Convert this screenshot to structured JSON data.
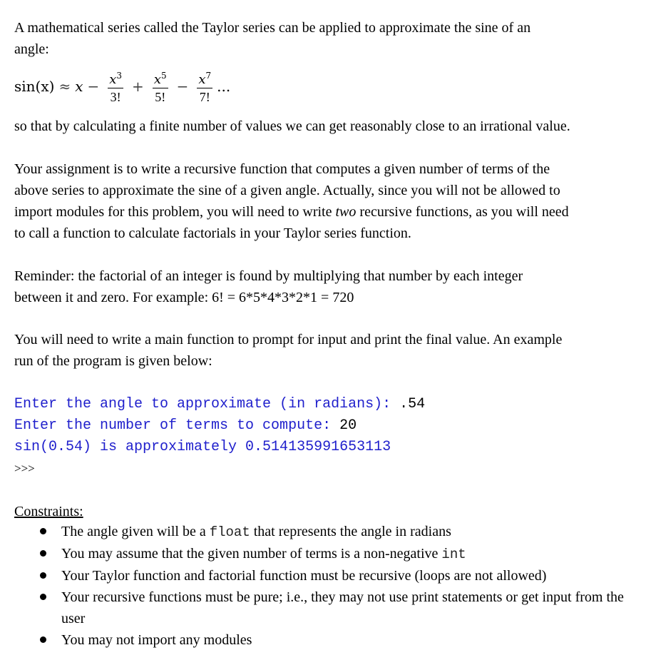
{
  "intro": {
    "line1": "A mathematical series called the Taylor series can be applied to approximate the sine of an",
    "line2": "angle:"
  },
  "formula": {
    "lhs": "sin(x)",
    "approx": "≈",
    "x": "x",
    "minus1": "−",
    "term1_num": "x",
    "term1_exp": "3",
    "term1_den": "3!",
    "plus": "+",
    "term2_num": "x",
    "term2_exp": "5",
    "term2_den": "5!",
    "minus2": "−",
    "term3_num": "x",
    "term3_exp": "7",
    "term3_den": "7!",
    "ellipsis": "..."
  },
  "para1": "so that by calculating a finite number of values we can get reasonably close to an irrational value.",
  "para2": {
    "line1": "Your assignment is to write a recursive function that computes a given number of terms of the",
    "line2": "above series to approximate the sine of a given angle. Actually, since you will not be allowed to",
    "line3_a": "import modules for this problem, you will need to write ",
    "line3_em": "two",
    "line3_b": " recursive functions, as you will need",
    "line4": "to call a function to calculate factorials in your Taylor series function."
  },
  "para3": {
    "line1": "Reminder: the factorial of an integer is found by multiplying that number by each integer",
    "line2": "between it and zero. For example: 6! = 6*5*4*3*2*1 = 720"
  },
  "para4": {
    "line1": "You will need to write a main function to prompt for input and print the final value. An example",
    "line2": "run of the program is given below:"
  },
  "example_run": {
    "line1_prompt": "Enter the angle to approximate (in radians): ",
    "line1_input": ".54",
    "line2_prompt": "Enter the number of terms to compute: ",
    "line2_input": "20",
    "line3_output": "sin(0.54) is approximately 0.514135991653113",
    "shell_prompt": ">>>"
  },
  "constraints": {
    "title": "Constraints:",
    "items": [
      {
        "a": "The angle given will be a ",
        "code": "float",
        "b": " that represents the angle in radians"
      },
      {
        "a": "You may assume that the given number of terms is a non-negative ",
        "code": "int",
        "b": ""
      },
      {
        "a": "Your Taylor function and factorial function must be recursive (loops are not allowed)",
        "code": "",
        "b": ""
      },
      {
        "a": "Your recursive functions must be pure; i.e., they may not use print statements or get input from the user",
        "code": "",
        "b": ""
      },
      {
        "a": "You may not import any modules",
        "code": "",
        "b": ""
      }
    ]
  },
  "colors": {
    "code_blue": "#1f1fcc",
    "text": "#000000"
  }
}
